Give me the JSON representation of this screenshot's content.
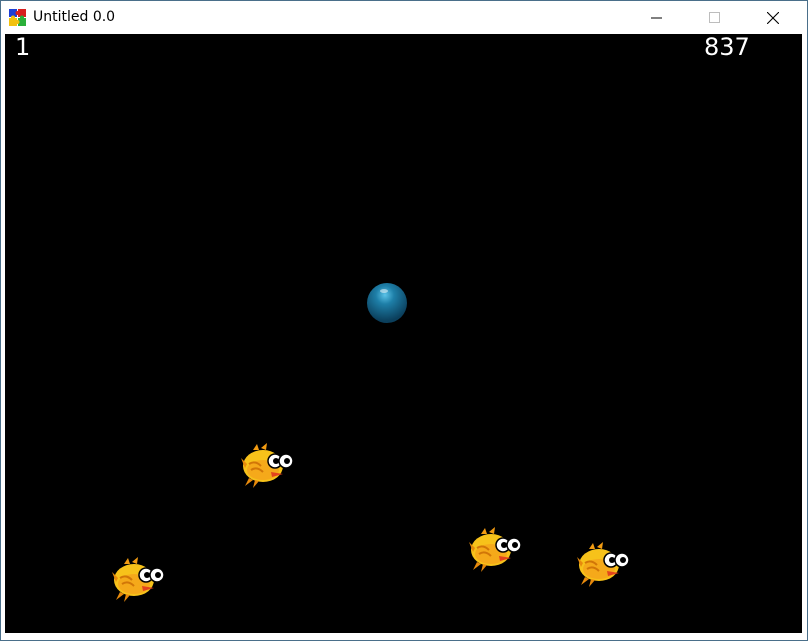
{
  "window": {
    "title": "Untitled 0.0",
    "icon": "puzzle-app-icon",
    "controls": [
      "minimize-icon",
      "maximize-icon",
      "close-icon"
    ]
  },
  "hud": {
    "level": "1",
    "score": "837"
  },
  "game": {
    "background_color": "#000000",
    "ball": {
      "icon": "ball-sprite",
      "color": "#1a6e95"
    },
    "birds": [
      {
        "icon": "yellow-bird-sprite"
      },
      {
        "icon": "yellow-bird-sprite"
      },
      {
        "icon": "yellow-bird-sprite"
      },
      {
        "icon": "yellow-bird-sprite"
      }
    ],
    "bird_color": "#f7c21a"
  }
}
